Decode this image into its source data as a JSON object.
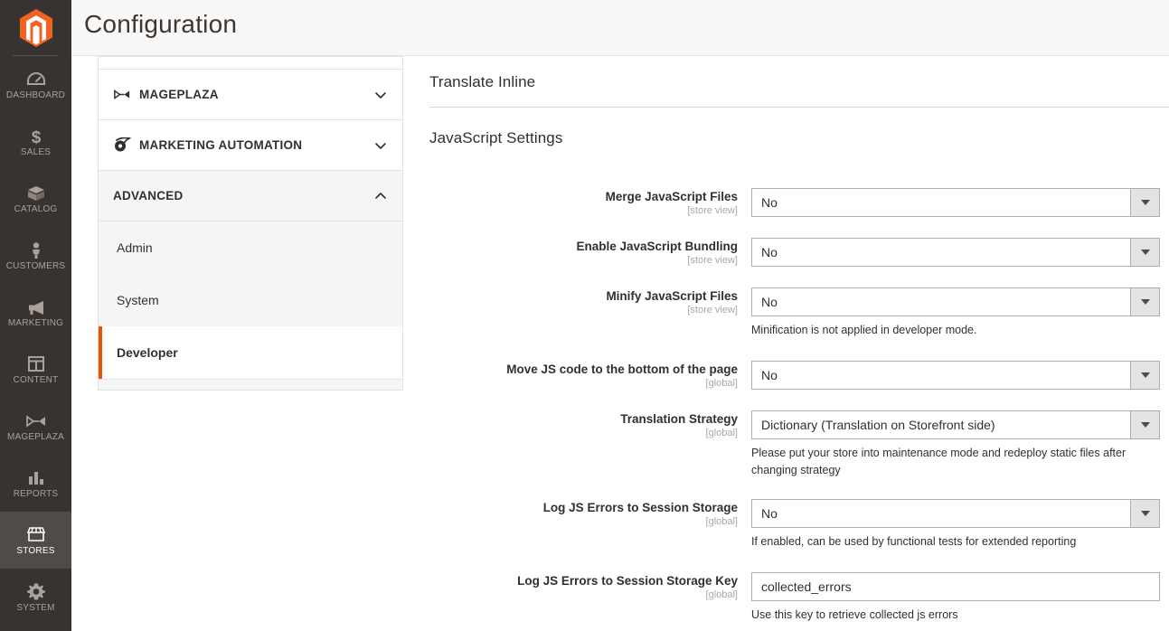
{
  "header": {
    "title": "Configuration",
    "logo_icon": "magento-logo-icon"
  },
  "admin_nav": {
    "items": [
      {
        "label": "DASHBOARD",
        "icon": "dashboard-icon",
        "active": false
      },
      {
        "label": "SALES",
        "icon": "dollar-icon",
        "active": false
      },
      {
        "label": "CATALOG",
        "icon": "box-icon",
        "active": false
      },
      {
        "label": "CUSTOMERS",
        "icon": "person-icon",
        "active": false
      },
      {
        "label": "MARKETING",
        "icon": "megaphone-icon",
        "active": false
      },
      {
        "label": "CONTENT",
        "icon": "layout-icon",
        "active": false
      },
      {
        "label": "MAGEPLAZA",
        "icon": "mageplaza-bowtie-icon",
        "active": false
      },
      {
        "label": "REPORTS",
        "icon": "bar-chart-icon",
        "active": false
      },
      {
        "label": "STORES",
        "icon": "storefront-icon",
        "active": true
      },
      {
        "label": "SYSTEM",
        "icon": "gear-icon",
        "active": false
      }
    ]
  },
  "config_nav": {
    "sections": [
      {
        "label": "MAGEPLAZA",
        "icon": "mageplaza-bowtie-icon",
        "expanded": false,
        "chevron": "chevron-down-icon"
      },
      {
        "label": "MARKETING AUTOMATION",
        "icon": "marketing-automation-icon",
        "expanded": false,
        "chevron": "chevron-down-icon"
      },
      {
        "label": "ADVANCED",
        "icon": "",
        "expanded": true,
        "chevron": "chevron-up-icon"
      }
    ],
    "advanced_items": [
      {
        "label": "Admin",
        "active": false
      },
      {
        "label": "System",
        "active": false
      },
      {
        "label": "Developer",
        "active": true
      }
    ]
  },
  "main": {
    "section_translate_inline": "Translate Inline",
    "section_javascript": "JavaScript Settings",
    "fields": [
      {
        "label": "Merge JavaScript Files",
        "scope": "[store view]",
        "type": "select",
        "value": "No",
        "note": ""
      },
      {
        "label": "Enable JavaScript Bundling",
        "scope": "[store view]",
        "type": "select",
        "value": "No",
        "note": ""
      },
      {
        "label": "Minify JavaScript Files",
        "scope": "[store view]",
        "type": "select",
        "value": "No",
        "note": "Minification is not applied in developer mode."
      },
      {
        "label": "Move JS code to the bottom of the page",
        "scope": "[global]",
        "type": "select",
        "value": "No",
        "note": ""
      },
      {
        "label": "Translation Strategy",
        "scope": "[global]",
        "type": "select",
        "value": "Dictionary (Translation on Storefront side)",
        "note": "Please put your store into maintenance mode and redeploy static files after changing strategy"
      },
      {
        "label": "Log JS Errors to Session Storage",
        "scope": "[global]",
        "type": "select",
        "value": "No",
        "note": "If enabled, can be used by functional tests for extended reporting"
      },
      {
        "label": "Log JS Errors to Session Storage Key",
        "scope": "[global]",
        "type": "text",
        "value": "collected_errors",
        "note": "Use this key to retrieve collected js errors"
      }
    ]
  },
  "colors": {
    "accent_orange": "#eb5202",
    "nav_dark": "#373330",
    "nav_active": "#4f4b47",
    "border": "#e3e3e3",
    "text_dark": "#303030"
  }
}
